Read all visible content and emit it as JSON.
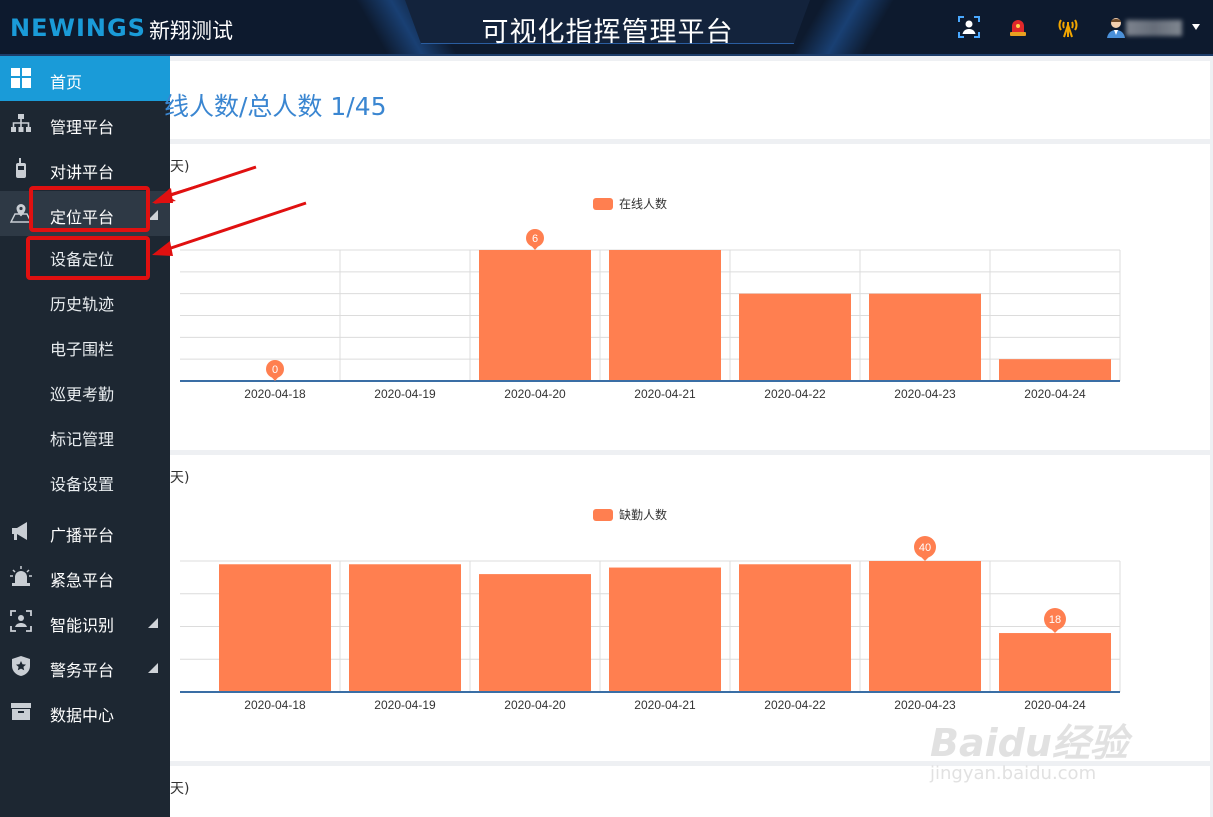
{
  "header": {
    "brand_logo": "NEWINGS",
    "brand_name": "新翔测试",
    "platform_title": "可视化指挥管理平台"
  },
  "sidebar": {
    "items": [
      {
        "label": "首页",
        "icon": "dashboard-icon"
      },
      {
        "label": "管理平台",
        "icon": "org-chart-icon"
      },
      {
        "label": "对讲平台",
        "icon": "walkie-talkie-icon"
      },
      {
        "label": "定位平台",
        "icon": "map-pin-icon"
      },
      {
        "label": "设备定位"
      },
      {
        "label": "历史轨迹"
      },
      {
        "label": "电子围栏"
      },
      {
        "label": "巡更考勤"
      },
      {
        "label": "标记管理"
      },
      {
        "label": "设备设置"
      },
      {
        "label": "广播平台",
        "icon": "megaphone-icon"
      },
      {
        "label": "紧急平台",
        "icon": "siren-icon"
      },
      {
        "label": "智能识别",
        "icon": "face-scan-icon"
      },
      {
        "label": "警务平台",
        "icon": "police-badge-icon"
      },
      {
        "label": "数据中心",
        "icon": "database-icon"
      }
    ]
  },
  "summary": {
    "text": "线人数/总人数   1/45"
  },
  "panel_titles": [
    "天)",
    "天)",
    "天)"
  ],
  "colors": {
    "accent": "#1a9bd8",
    "bar": "#ff7f50",
    "annotation": "#e01010"
  },
  "chart_data": [
    {
      "type": "bar",
      "legend": "在线人数",
      "categories": [
        "2020-04-18",
        "2020-04-19",
        "2020-04-20",
        "2020-04-21",
        "2020-04-22",
        "2020-04-23",
        "2020-04-24"
      ],
      "values": [
        0,
        0,
        6,
        6,
        4,
        4,
        1
      ],
      "pins": [
        {
          "index": 0,
          "label": "0"
        },
        {
          "index": 2,
          "label": "6"
        }
      ],
      "ylim": [
        0,
        6
      ],
      "grid": true
    },
    {
      "type": "bar",
      "legend": "缺勤人数",
      "categories": [
        "2020-04-18",
        "2020-04-19",
        "2020-04-20",
        "2020-04-21",
        "2020-04-22",
        "2020-04-23",
        "2020-04-24"
      ],
      "values": [
        39,
        39,
        36,
        38,
        39,
        40,
        18
      ],
      "pins": [
        {
          "index": 5,
          "label": "40"
        },
        {
          "index": 6,
          "label": "18"
        }
      ],
      "ylim": [
        0,
        40
      ],
      "grid": true
    }
  ],
  "watermark": {
    "main": "Baidu经验",
    "sub": "jingyan.baidu.com"
  }
}
